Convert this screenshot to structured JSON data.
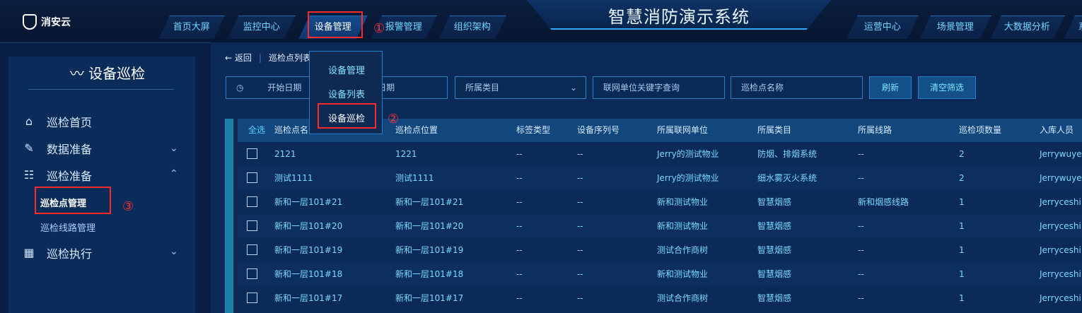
{
  "header": {
    "logo_text": "消安云",
    "system_title": "智慧消防演示系统",
    "nav_left": [
      "首页大屏",
      "监控中心",
      "设备管理",
      "报警管理",
      "组织架构"
    ],
    "nav_right": [
      "运营中心",
      "场景管理",
      "大数据分析",
      "系"
    ]
  },
  "dropdown": {
    "items": [
      "设备管理",
      "设备列表",
      "设备巡检"
    ]
  },
  "annotations": {
    "mark1": "①",
    "mark2": "②",
    "mark3": "③"
  },
  "sidebar": {
    "title": "设备巡检",
    "title_icon": "inspection-icon",
    "menu": [
      {
        "label": "巡检首页",
        "icon": "home-icon"
      },
      {
        "label": "数据准备",
        "icon": "document-edit-icon"
      },
      {
        "label": "巡检准备",
        "icon": "checklist-icon"
      },
      {
        "label": "巡检执行",
        "icon": "grid-icon"
      }
    ],
    "submenu": [
      "巡检点管理",
      "巡检线路管理"
    ]
  },
  "breadcrumb": {
    "back": "返回",
    "current": "巡检点列表"
  },
  "filters": {
    "start_date": "开始日期",
    "end_date": "日期",
    "category": "所属类目",
    "unit_search": "联网单位关键字查询",
    "point_name": "巡检点名称",
    "refresh": "刷新",
    "clear": "清空筛选"
  },
  "table": {
    "select_all": "全选",
    "columns": [
      "巡检点名",
      "巡检点位置",
      "标签类型",
      "设备序列号",
      "所属联网单位",
      "所属类目",
      "所属线路",
      "巡检项数量",
      "入库人员"
    ],
    "rows": [
      [
        "2121",
        "1221",
        "--",
        "--",
        "Jerry的测试物业",
        "防烟、排烟系统",
        "--",
        "2",
        "Jerrywuyeq"
      ],
      [
        "测试1111",
        "测试1111",
        "--",
        "--",
        "Jerry的测试物业",
        "细水雾灭火系统",
        "--",
        "2",
        "Jerrywuyeq"
      ],
      [
        "新和一层101#21",
        "新和一层101#21",
        "--",
        "--",
        "新和测试物业",
        "智慧烟感",
        "新和烟感线路",
        "1",
        "Jerryceshi"
      ],
      [
        "新和一层101#20",
        "新和一层101#20",
        "--",
        "--",
        "新和测试物业",
        "智慧烟感",
        "--",
        "1",
        "Jerryceshi"
      ],
      [
        "新和一层101#19",
        "新和一层101#19",
        "--",
        "--",
        "测试合作商树",
        "智慧烟感",
        "--",
        "1",
        "Jerryceshi"
      ],
      [
        "新和一层101#18",
        "新和一层101#18",
        "--",
        "--",
        "新和测试物业",
        "智慧烟感",
        "--",
        "1",
        "Jerryceshi"
      ],
      [
        "新和一层101#17",
        "新和一层101#17",
        "--",
        "--",
        "测试合作商树",
        "智慧烟感",
        "--",
        "1",
        "Jerryceshi"
      ]
    ]
  }
}
